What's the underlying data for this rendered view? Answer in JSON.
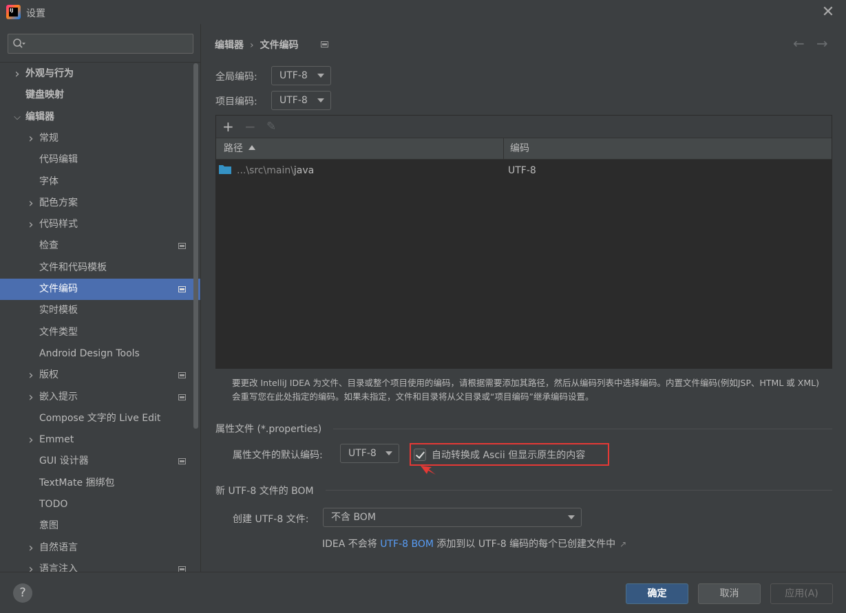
{
  "window": {
    "title": "设置",
    "app_icon_text": "IJ"
  },
  "search": {
    "placeholder": ""
  },
  "sidebar": {
    "items": [
      {
        "label": "外观与行为",
        "level": 0,
        "chevron": "right",
        "bold": true
      },
      {
        "label": "键盘映射",
        "level": 0,
        "chevron": "",
        "bold": true
      },
      {
        "label": "编辑器",
        "level": 0,
        "chevron": "down",
        "bold": true
      },
      {
        "label": "常规",
        "level": 1,
        "chevron": "right"
      },
      {
        "label": "代码编辑",
        "level": 1,
        "chevron": ""
      },
      {
        "label": "字体",
        "level": 1,
        "chevron": ""
      },
      {
        "label": "配色方案",
        "level": 1,
        "chevron": "right"
      },
      {
        "label": "代码样式",
        "level": 1,
        "chevron": "right"
      },
      {
        "label": "检查",
        "level": 1,
        "chevron": "",
        "project_icon": true
      },
      {
        "label": "文件和代码模板",
        "level": 1,
        "chevron": ""
      },
      {
        "label": "文件编码",
        "level": 1,
        "chevron": "",
        "project_icon": true,
        "selected": true
      },
      {
        "label": "实时模板",
        "level": 1,
        "chevron": ""
      },
      {
        "label": "文件类型",
        "level": 1,
        "chevron": ""
      },
      {
        "label": "Android Design Tools",
        "level": 1,
        "chevron": ""
      },
      {
        "label": "版权",
        "level": 1,
        "chevron": "right",
        "project_icon": true
      },
      {
        "label": "嵌入提示",
        "level": 1,
        "chevron": "right",
        "project_icon": true
      },
      {
        "label": "Compose 文字的 Live Edit",
        "level": 1,
        "chevron": ""
      },
      {
        "label": "Emmet",
        "level": 1,
        "chevron": "right"
      },
      {
        "label": "GUI 设计器",
        "level": 1,
        "chevron": "",
        "project_icon": true
      },
      {
        "label": "TextMate 捆绑包",
        "level": 1,
        "chevron": ""
      },
      {
        "label": "TODO",
        "level": 1,
        "chevron": ""
      },
      {
        "label": "意图",
        "level": 1,
        "chevron": ""
      },
      {
        "label": "自然语言",
        "level": 1,
        "chevron": "right"
      },
      {
        "label": "语言注入",
        "level": 1,
        "chevron": "right",
        "project_icon": true
      }
    ]
  },
  "breadcrumb": {
    "parent": "编辑器",
    "separator": "›",
    "current": "文件编码"
  },
  "nav": {
    "back": "←",
    "forward": "→"
  },
  "global_encoding": {
    "label": "全局编码:",
    "value": "UTF-8"
  },
  "project_encoding": {
    "label": "项目编码:",
    "value": "UTF-8"
  },
  "table": {
    "toolbar": {
      "add": "+",
      "remove": "−",
      "edit": "✎"
    },
    "columns": [
      "路径",
      "编码"
    ],
    "rows": [
      {
        "path_prefix": "...\\src\\main\\",
        "path_tail": "java",
        "encoding": "UTF-8"
      }
    ]
  },
  "help_text": "要更改 IntelliJ IDEA 为文件、目录或整个项目使用的编码，请根据需要添加其路径，然后从编码列表中选择编码。内置文件编码(例如JSP、HTML 或 XML)会重写您在此处指定的编码。如果未指定，文件和目录将从父目录或“项目编码”继承编码设置。",
  "properties": {
    "section_title": "属性文件 (*.properties)",
    "default_label": "属性文件的默认编码:",
    "default_value": "UTF-8",
    "transparent_label": "自动转换成 Ascii 但显示原生的内容",
    "transparent_checked": true
  },
  "bom": {
    "section_title": "新 UTF-8 文件的 BOM",
    "create_label": "创建 UTF-8 文件:",
    "create_value": "不含 BOM",
    "note_before": "IDEA 不会将 ",
    "note_link": "UTF-8 BOM",
    "note_after": " 添加到以 UTF-8 编码的每个已创建文件中",
    "note_icon": "↗"
  },
  "footer": {
    "help": "?",
    "ok": "确定",
    "cancel": "取消",
    "apply": "应用(A)"
  },
  "colors": {
    "selection": "#4b6eaf",
    "link": "#589df6",
    "highlight": "#e53935",
    "folder": "#3592c4"
  }
}
